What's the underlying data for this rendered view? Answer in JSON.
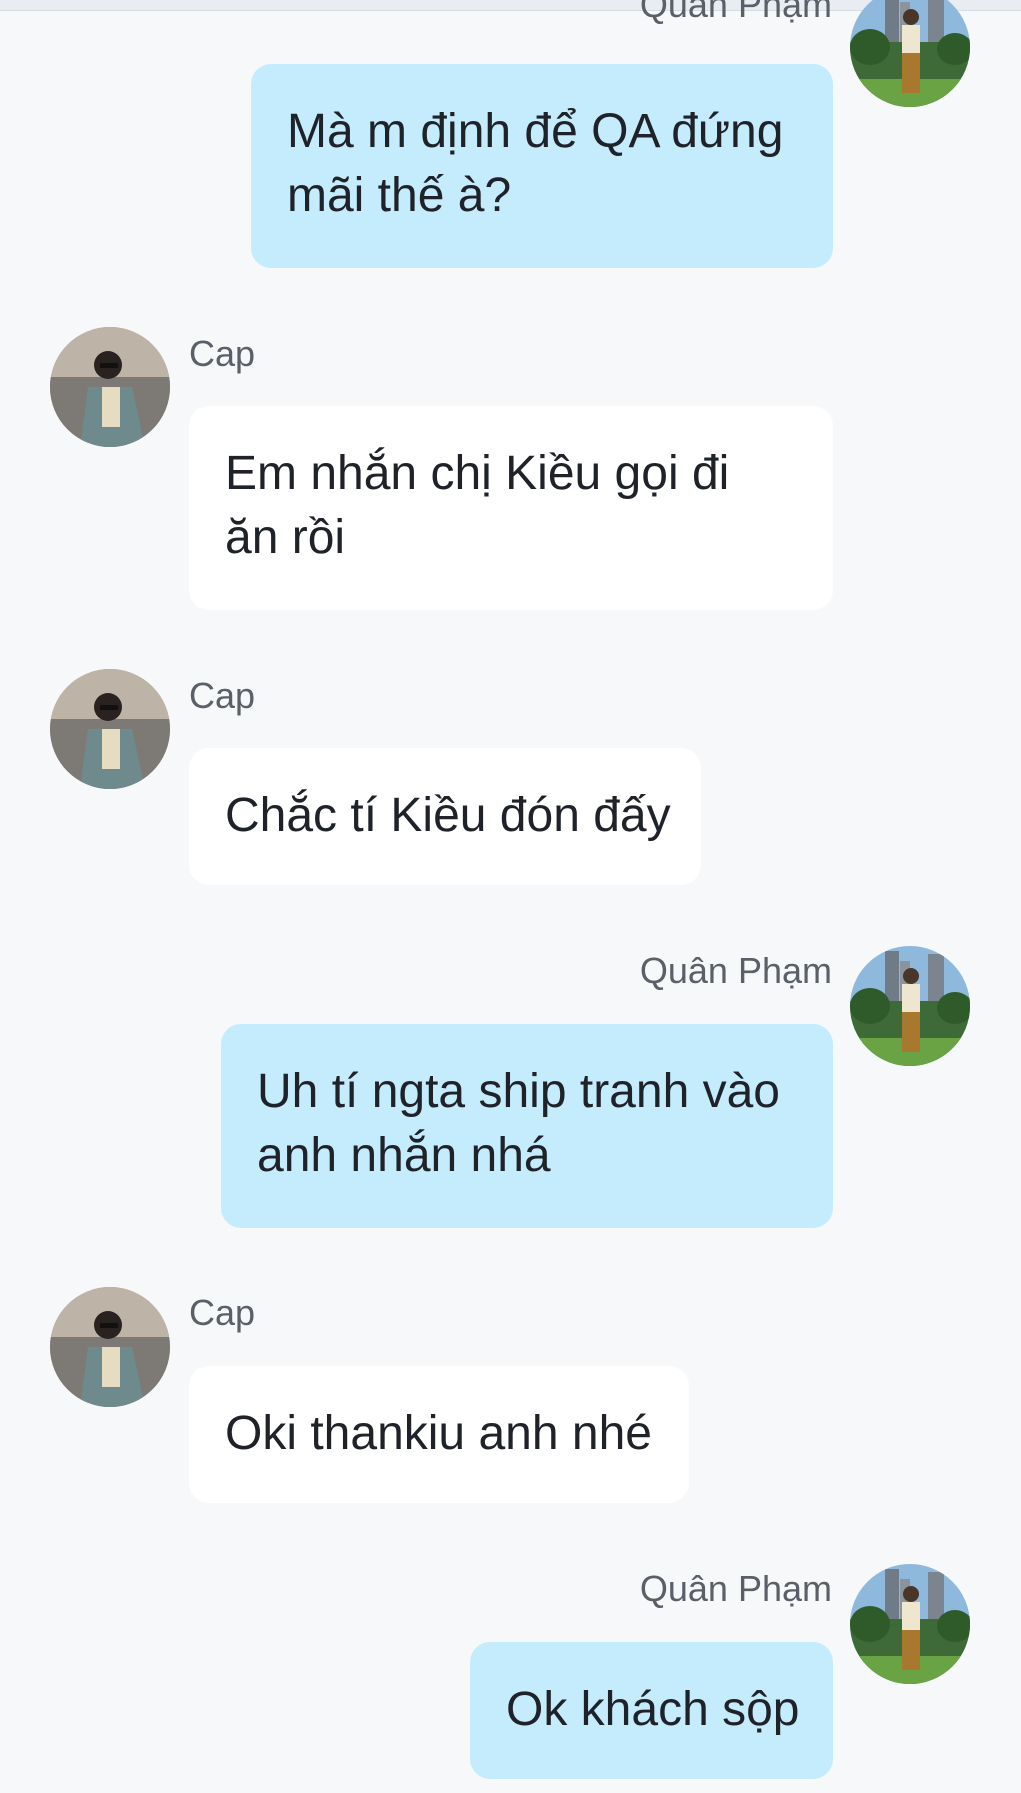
{
  "conversation": {
    "messages": [
      {
        "sender": "Quân Phạm",
        "side": "right",
        "lines": [
          "Mà m định để QA đứng",
          "mãi thế à?"
        ]
      },
      {
        "sender": "Cap",
        "side": "left",
        "lines": [
          "Em nhắn chị Kiều gọi đi",
          "ăn rồi"
        ]
      },
      {
        "sender": "Cap",
        "side": "left",
        "lines": [
          "Chắc tí Kiều đón đấy"
        ]
      },
      {
        "sender": "Quân Phạm",
        "side": "right",
        "lines": [
          "Uh tí ngta ship tranh vào",
          "anh nhắn nhá"
        ]
      },
      {
        "sender": "Cap",
        "side": "left",
        "lines": [
          "Oki thankiu anh nhé"
        ]
      },
      {
        "sender": "Quân Phạm",
        "side": "right",
        "lines": [
          "Ok khách sộp"
        ]
      }
    ]
  },
  "avatars": {
    "quan_pham": "avatar-photo-outdoor-buildings",
    "cap": "avatar-photo-street-jacket"
  },
  "colors": {
    "background": "#f6f8fa",
    "outgoing_bubble": "#c5ecfd",
    "incoming_bubble": "#ffffff",
    "text": "#1f2329",
    "sender_name": "#5b6068"
  }
}
